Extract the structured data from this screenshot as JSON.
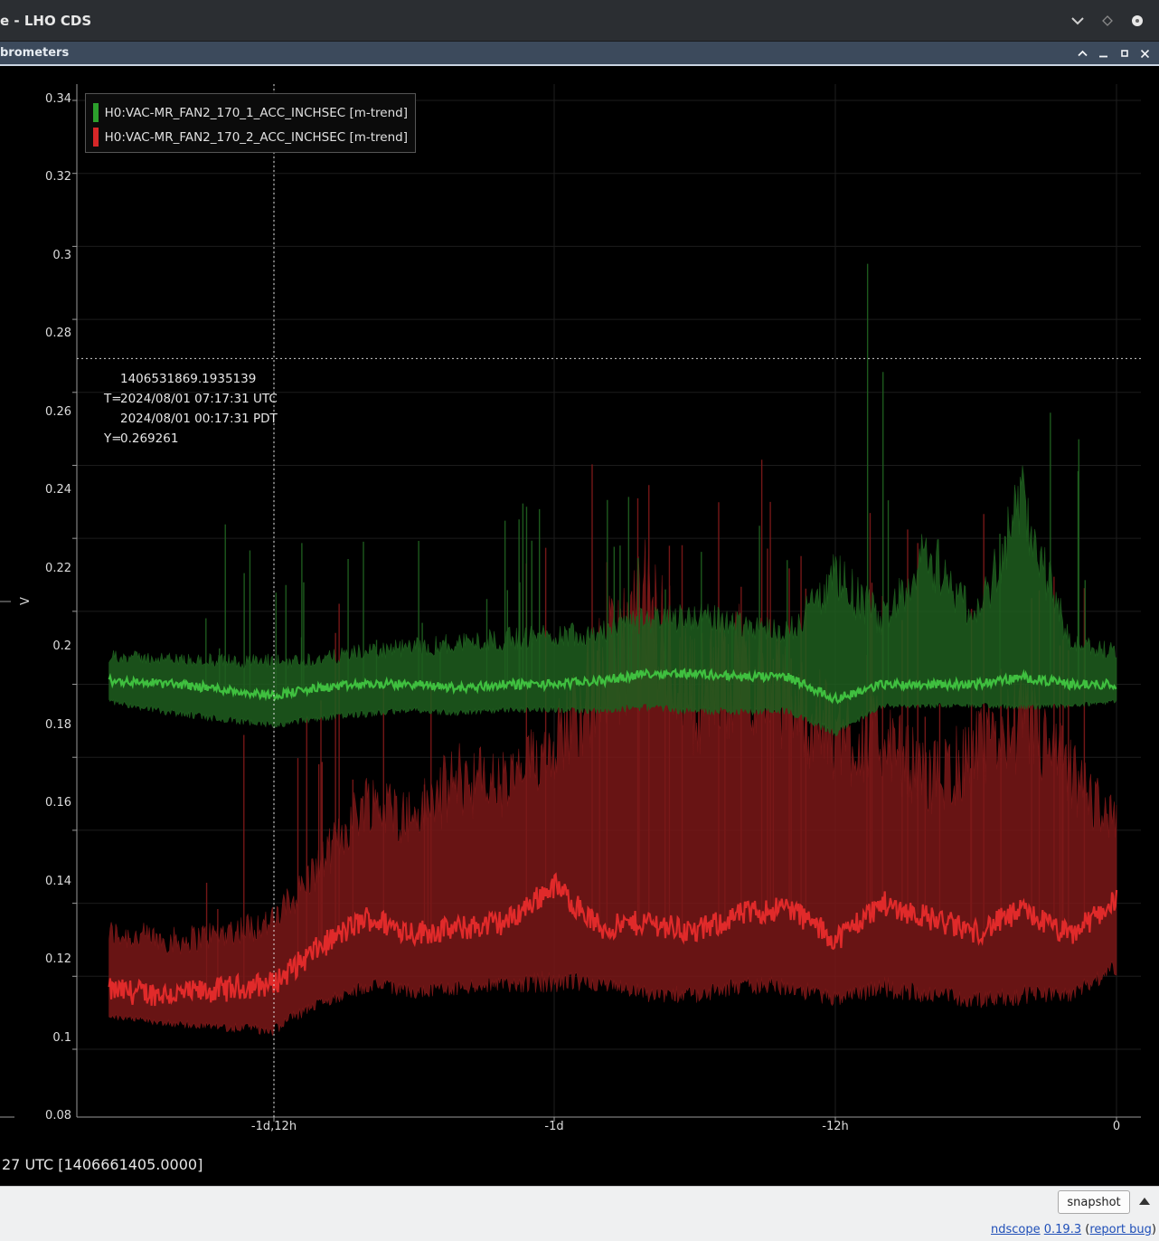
{
  "window": {
    "title": "e - LHO CDS",
    "panel_title": "brometers"
  },
  "plot": {
    "y_axis_label": "V",
    "y_ticks": [
      "0.34",
      "0.32",
      "0.3",
      "0.28",
      "0.26",
      "0.24",
      "0.22",
      "0.2",
      "0.18",
      "0.16",
      "0.14",
      "0.12",
      "0.1",
      "0.08"
    ],
    "x_ticks": [
      "-1d,12h",
      "-1d",
      "-12h",
      "0"
    ],
    "legend": [
      {
        "label": "H0:VAC-MR_FAN2_170_1_ACC_INCHSEC [m-trend]",
        "color": "#2ca02c"
      },
      {
        "label": "H0:VAC-MR_FAN2_170_2_ACC_INCHSEC [m-trend]",
        "color": "#d62728"
      }
    ],
    "cursor": {
      "gps": "1406531869.1935139",
      "t_label": "T=",
      "utc": "2024/08/01 07:17:31 UTC",
      "pdt": "2024/08/01 00:17:31 PDT",
      "y_label": "Y=",
      "y_value": "0.269261"
    },
    "bottom_time": "27 UTC [1406661405.0000]"
  },
  "chart_data": {
    "type": "line",
    "xlabel": "",
    "ylabel": "V",
    "x_ticks": [
      "-1d,12h",
      "-1d",
      "-12h",
      "0"
    ],
    "xlim_hours": [
      -43,
      0
    ],
    "ylim": [
      0.068,
      0.345
    ],
    "grid": true,
    "legend_position": "top-left",
    "x_hours": [
      -43,
      -40,
      -36,
      -34,
      -32,
      -30,
      -28,
      -26,
      -24,
      -22,
      -20,
      -18,
      -16,
      -14,
      -12,
      -10,
      -8,
      -6,
      -4,
      -2,
      0
    ],
    "series": [
      {
        "name": "H0:VAC-MR_FAN2_170_1_ACC_INCHSEC [m-trend]",
        "color": "#2ca02c",
        "mean": [
          0.181,
          0.18,
          0.177,
          0.179,
          0.18,
          0.18,
          0.179,
          0.18,
          0.18,
          0.181,
          0.183,
          0.183,
          0.182,
          0.182,
          0.176,
          0.18,
          0.18,
          0.18,
          0.182,
          0.18,
          0.18
        ],
        "max": [
          0.187,
          0.186,
          0.185,
          0.186,
          0.188,
          0.189,
          0.19,
          0.191,
          0.192,
          0.193,
          0.196,
          0.197,
          0.195,
          0.193,
          0.205,
          0.196,
          0.212,
          0.196,
          0.225,
          0.19,
          0.188
        ],
        "min": [
          0.176,
          0.173,
          0.17,
          0.172,
          0.173,
          0.174,
          0.173,
          0.174,
          0.174,
          0.174,
          0.175,
          0.174,
          0.174,
          0.174,
          0.168,
          0.175,
          0.175,
          0.175,
          0.175,
          0.175,
          0.176
        ]
      },
      {
        "name": "H0:VAC-MR_FAN2_170_2_ACC_INCHSEC [m-trend]",
        "color": "#d62728",
        "mean": [
          0.096,
          0.095,
          0.098,
          0.108,
          0.116,
          0.112,
          0.113,
          0.115,
          0.125,
          0.113,
          0.115,
          0.112,
          0.117,
          0.119,
          0.11,
          0.12,
          0.116,
          0.112,
          0.118,
          0.111,
          0.121
        ],
        "max": [
          0.11,
          0.108,
          0.113,
          0.128,
          0.145,
          0.14,
          0.15,
          0.148,
          0.16,
          0.175,
          0.19,
          0.17,
          0.178,
          0.17,
          0.16,
          0.16,
          0.15,
          0.155,
          0.165,
          0.15,
          0.14
        ],
        "min": [
          0.09,
          0.088,
          0.087,
          0.095,
          0.1,
          0.098,
          0.099,
          0.1,
          0.102,
          0.1,
          0.098,
          0.097,
          0.1,
          0.1,
          0.096,
          0.1,
          0.098,
          0.096,
          0.098,
          0.097,
          0.105
        ]
      }
    ]
  },
  "status": {
    "snapshot_label": "snapshot",
    "app_name": "ndscope",
    "version": "0.19.3",
    "report_bug": "report bug"
  }
}
